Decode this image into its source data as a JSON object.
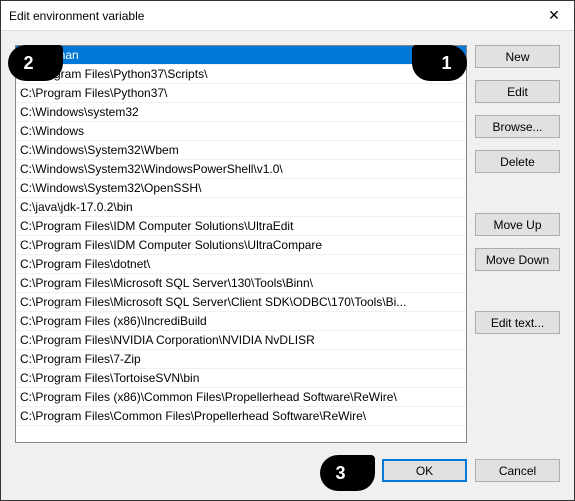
{
  "window": {
    "title": "Edit environment variable"
  },
  "list": {
    "items": [
      "C:\\certman",
      "C:\\Program Files\\Python37\\Scripts\\",
      "C:\\Program Files\\Python37\\",
      "C:\\Windows\\system32",
      "C:\\Windows",
      "C:\\Windows\\System32\\Wbem",
      "C:\\Windows\\System32\\WindowsPowerShell\\v1.0\\",
      "C:\\Windows\\System32\\OpenSSH\\",
      "C:\\java\\jdk-17.0.2\\bin",
      "C:\\Program Files\\IDM Computer Solutions\\UltraEdit",
      "C:\\Program Files\\IDM Computer Solutions\\UltraCompare",
      "C:\\Program Files\\dotnet\\",
      "C:\\Program Files\\Microsoft SQL Server\\130\\Tools\\Binn\\",
      "C:\\Program Files\\Microsoft SQL Server\\Client SDK\\ODBC\\170\\Tools\\Bi...",
      "C:\\Program Files (x86)\\IncrediBuild",
      "C:\\Program Files\\NVIDIA Corporation\\NVIDIA NvDLISR",
      "C:\\Program Files\\7-Zip",
      "C:\\Program Files\\TortoiseSVN\\bin",
      "C:\\Program Files (x86)\\Common Files\\Propellerhead Software\\ReWire\\",
      "C:\\Program Files\\Common Files\\Propellerhead Software\\ReWire\\"
    ],
    "selected_index": 0
  },
  "buttons": {
    "new_": "New",
    "edit": "Edit",
    "browse": "Browse...",
    "delete_": "Delete",
    "move_up": "Move Up",
    "move_down": "Move Down",
    "edit_text": "Edit text...",
    "ok": "OK",
    "cancel": "Cancel"
  },
  "annotations": {
    "one": "1",
    "two": "2",
    "three": "3"
  }
}
